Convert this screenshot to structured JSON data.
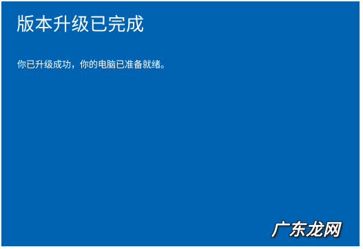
{
  "screen": {
    "title": "版本升级已完成",
    "message": "你已升级成功，你的电脑已准备就绪。",
    "background_color": "#0063b1",
    "text_color": "#ffffff"
  },
  "watermark": {
    "text": "广东龙网"
  }
}
